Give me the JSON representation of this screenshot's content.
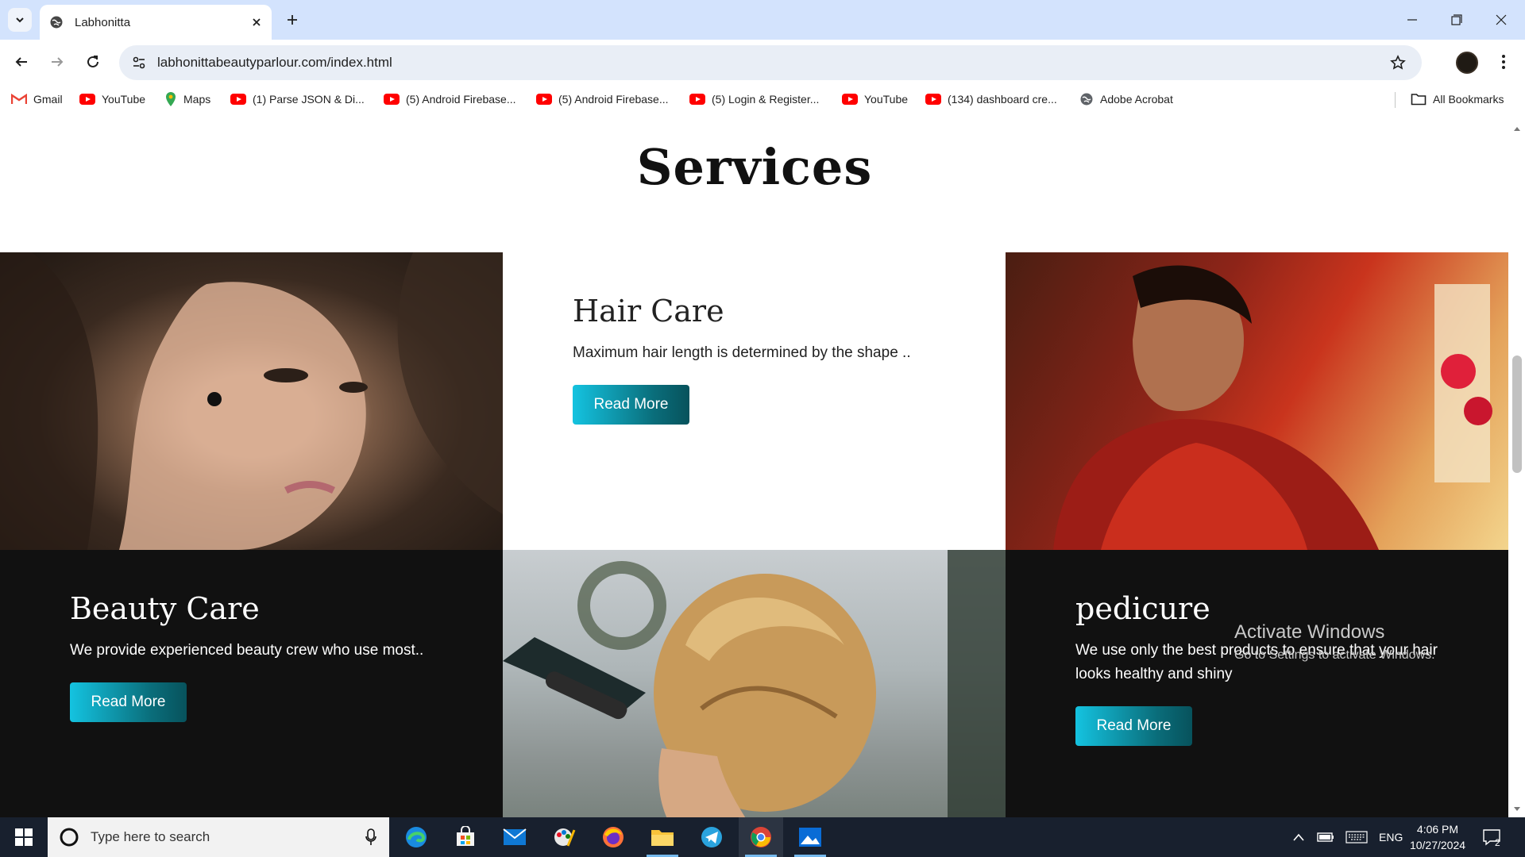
{
  "browser": {
    "tab_title": "Labhonitta",
    "url": "labhonittabeautyparlour.com/index.html",
    "bookmarks": [
      {
        "label": "Gmail",
        "icon": "gmail-icon"
      },
      {
        "label": "YouTube",
        "icon": "youtube-icon"
      },
      {
        "label": "Maps",
        "icon": "maps-icon"
      },
      {
        "label": "(1) Parse JSON & Di...",
        "icon": "youtube-icon"
      },
      {
        "label": "(5) Android Firebase...",
        "icon": "youtube-icon"
      },
      {
        "label": "(5) Android Firebase...",
        "icon": "youtube-icon"
      },
      {
        "label": "(5) Login & Register...",
        "icon": "youtube-icon"
      },
      {
        "label": "YouTube",
        "icon": "youtube-icon"
      },
      {
        "label": "(134) dashboard cre...",
        "icon": "youtube-icon"
      },
      {
        "label": "Adobe Acrobat",
        "icon": "globe-icon"
      }
    ],
    "all_bookmarks": "All Bookmarks"
  },
  "page": {
    "section_title": "Services",
    "services": [
      {
        "title": "Hair Care",
        "text": "Maximum hair length is determined by the shape ..",
        "button": "Read More"
      },
      {
        "title": "Beauty Care",
        "text": "We provide experienced beauty crew who use most..",
        "button": "Read More"
      },
      {
        "title": "pedicure",
        "text": "We use only the best products to ensure that your hair looks healthy and shiny",
        "button": "Read More"
      }
    ]
  },
  "watermark": {
    "line1": "Activate Windows",
    "line2": "Go to Settings to activate Windows."
  },
  "taskbar": {
    "search_placeholder": "Type here to search",
    "language": "ENG",
    "time": "4:06 PM",
    "date": "10/27/2024",
    "notification_count": "2"
  },
  "colors": {
    "tabstrip": "#d3e3fd",
    "dark_panel": "#111111",
    "button_gradient_start": "#14c3e0",
    "button_gradient_end": "#07525c",
    "taskbar": "#18202e"
  }
}
